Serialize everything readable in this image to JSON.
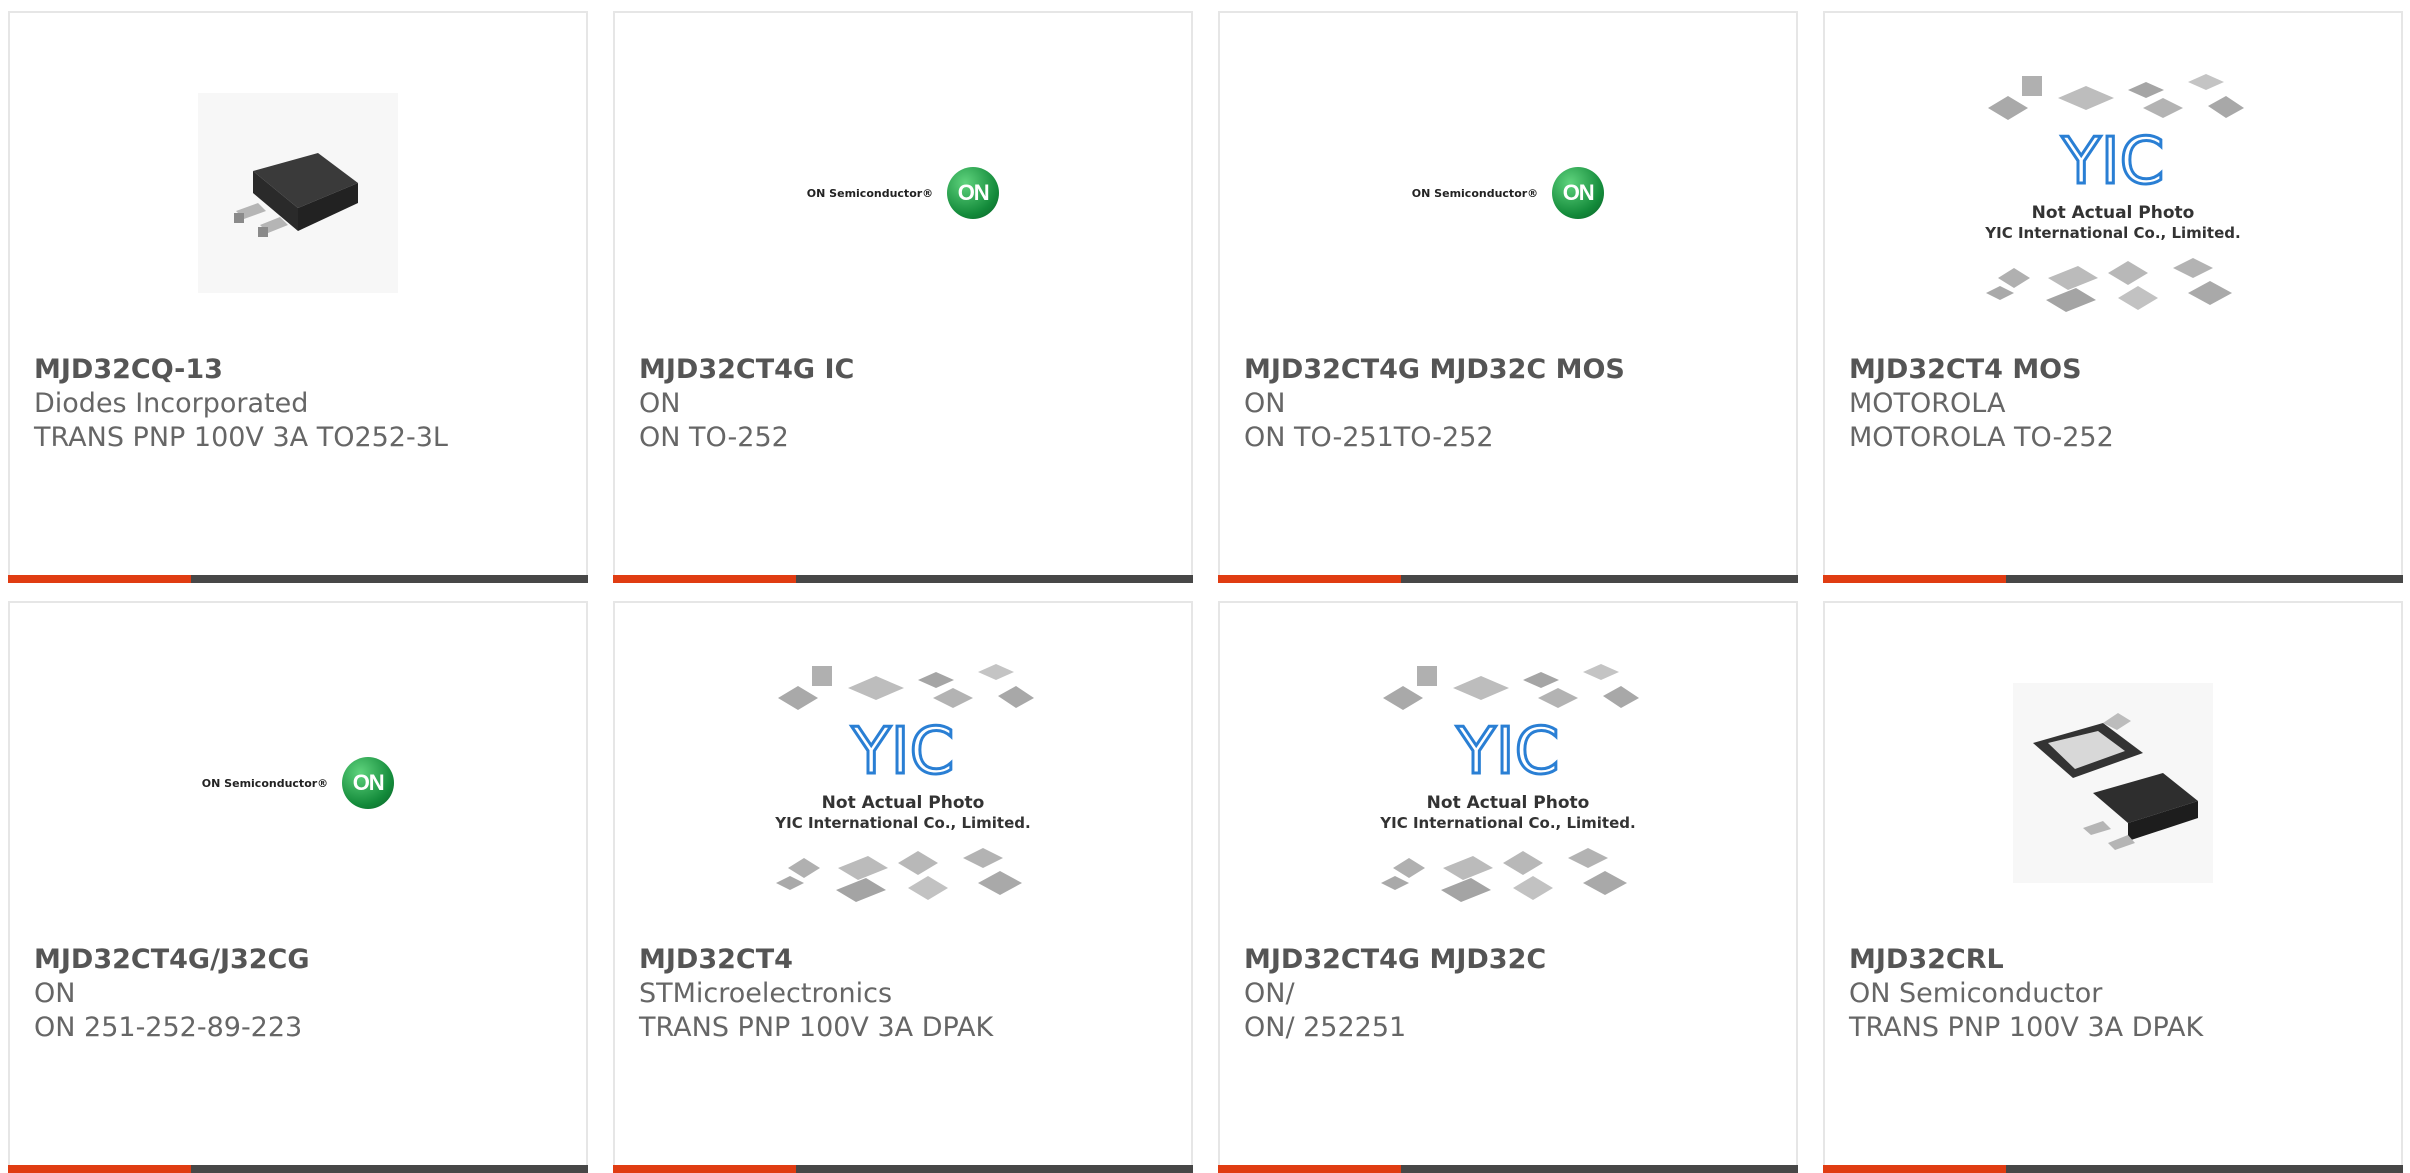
{
  "products": [
    {
      "part": "MJD32CQ-13",
      "manufacturer": "Diodes Incorporated",
      "description": "TRANS PNP 100V 3A TO252-3L",
      "image": "dpak-package-icon"
    },
    {
      "part": "MJD32CT4G IC",
      "manufacturer": "ON",
      "description": "ON TO-252",
      "image": "on-semiconductor-logo"
    },
    {
      "part": "MJD32CT4G MJD32C MOS",
      "manufacturer": "ON",
      "description": "ON TO-251TO-252",
      "image": "on-semiconductor-logo"
    },
    {
      "part": "MJD32CT4 MOS",
      "manufacturer": "MOTOROLA",
      "description": "MOTOROLA TO-252",
      "image": "yic-placeholder"
    },
    {
      "part": "MJD32CT4G/J32CG",
      "manufacturer": "ON",
      "description": "ON 251-252-89-223",
      "image": "on-semiconductor-logo"
    },
    {
      "part": "MJD32CT4",
      "manufacturer": "STMicroelectronics",
      "description": "TRANS PNP 100V 3A DPAK",
      "image": "yic-placeholder"
    },
    {
      "part": "MJD32CT4G MJD32C",
      "manufacturer": "ON/",
      "description": "ON/ 252251",
      "image": "yic-placeholder"
    },
    {
      "part": "MJD32CRL",
      "manufacturer": "ON Semiconductor",
      "description": "TRANS PNP 100V 3A DPAK",
      "image": "dpak-double-package-icon"
    }
  ],
  "logos": {
    "on_text": "ON Semiconductor®",
    "on_badge": "ON",
    "yic_mark": "YIC",
    "yic_line1": "Not Actual Photo",
    "yic_line2": "YIC International Co., Limited."
  },
  "colors": {
    "accent": "#e03c12",
    "bar": "#474747",
    "border": "#e6e6e6",
    "text": "#555555",
    "on_green": "#138a3a",
    "yic_blue": "#2a7fd4"
  }
}
